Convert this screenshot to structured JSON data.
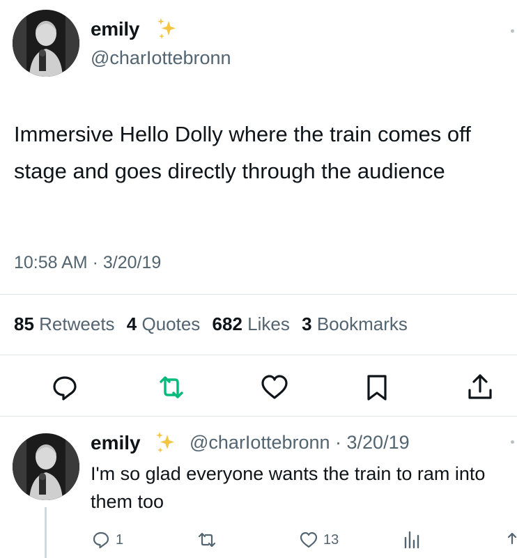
{
  "tweet": {
    "author_name": "emily",
    "author_handle": "@charIottebronn",
    "text": "Immersive Hello Dolly where the train comes off stage and goes directly through the audience",
    "timestamp": "10:58 AM · 3/20/19"
  },
  "stats": {
    "retweets": "85",
    "retweets_label": "Retweets",
    "quotes": "4",
    "quotes_label": "Quotes",
    "likes": "682",
    "likes_label": "Likes",
    "bookmarks": "3",
    "bookmarks_label": "Bookmarks"
  },
  "actions": {
    "icons": [
      "reply-icon",
      "retweet-icon",
      "like-icon",
      "bookmark-icon",
      "share-icon"
    ]
  },
  "reply": {
    "author_name": "emily",
    "meta": "@charIottebronn · 3/20/19",
    "text": "I'm so glad everyone wants the train to ram into them too",
    "reply_count": "1",
    "like_count": "13"
  },
  "colors": {
    "text": "#0f1419",
    "secondary": "#536471",
    "retweet_active": "#00ba7c",
    "divider": "#e1e6ea",
    "sparkle": "#f4c542"
  }
}
